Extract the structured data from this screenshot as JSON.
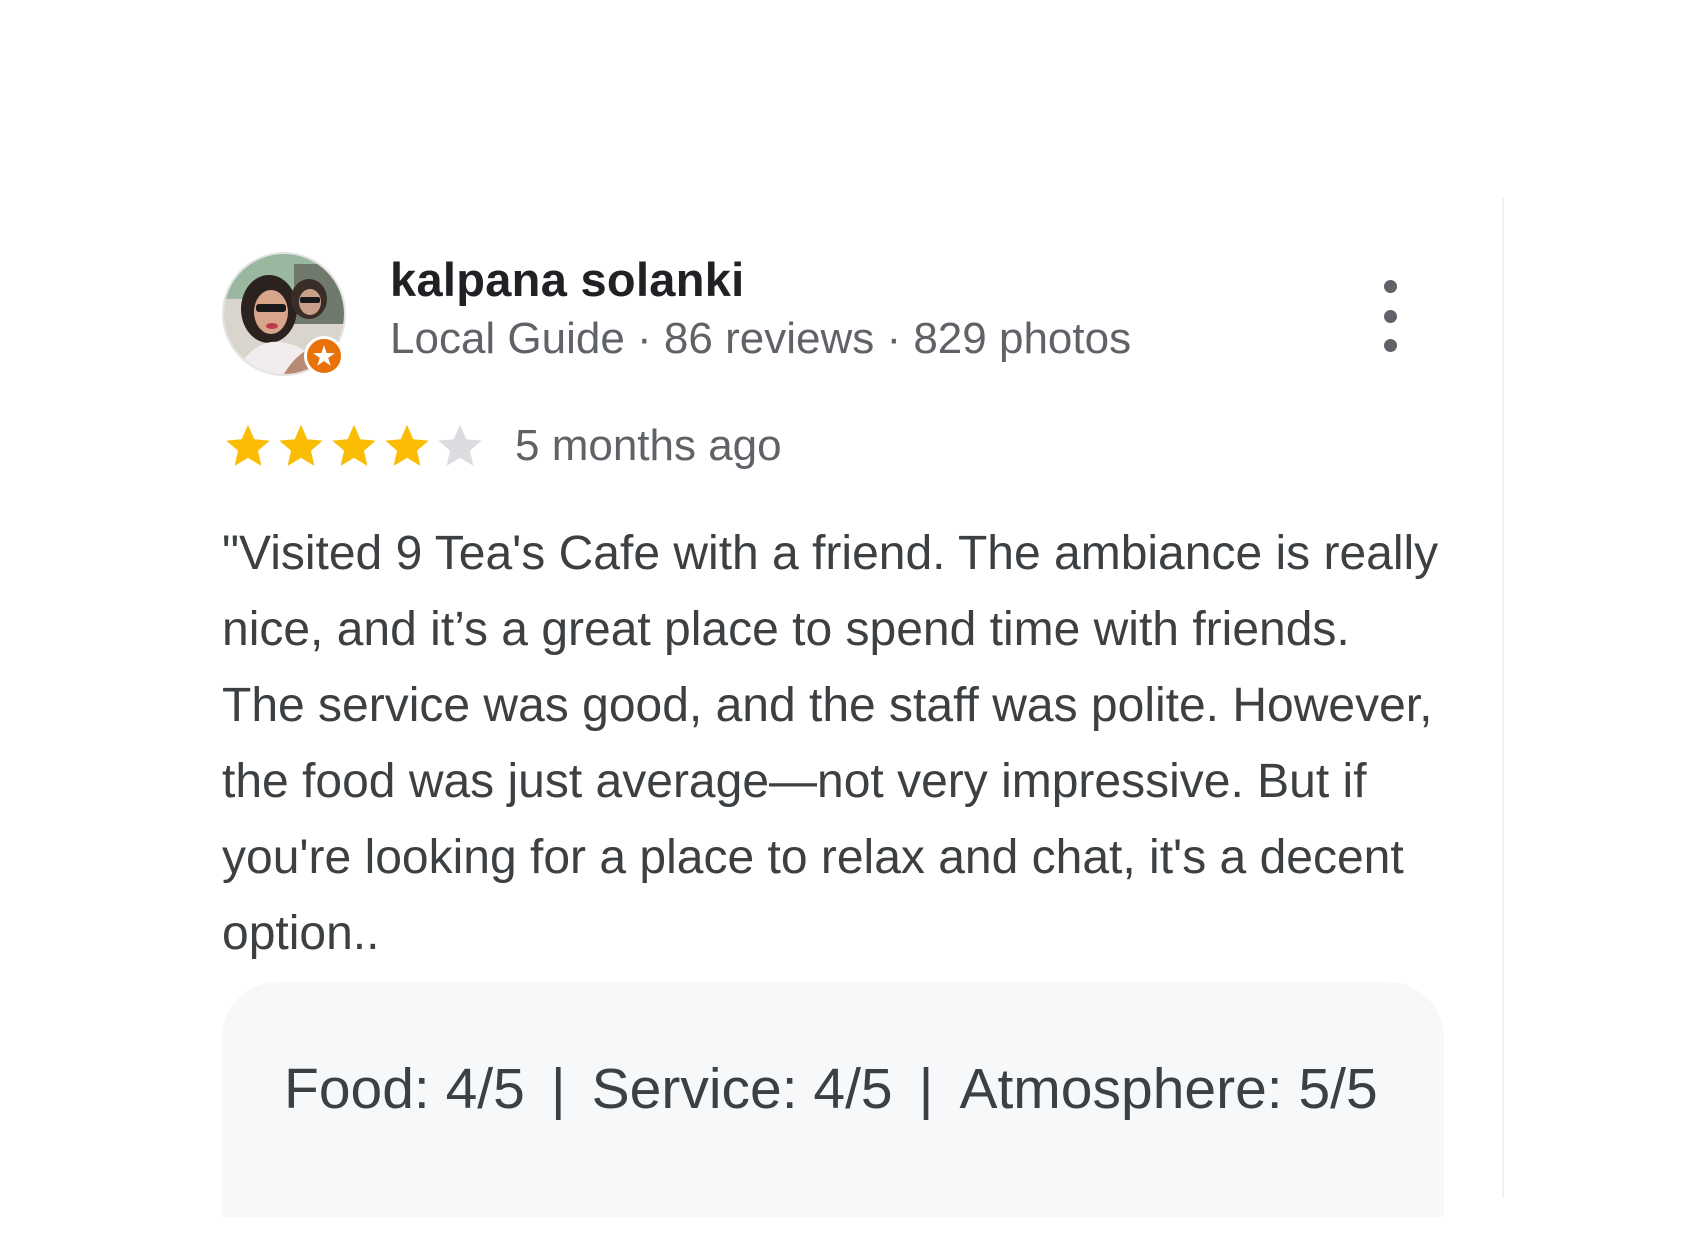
{
  "reviewer": {
    "name": "kalpana solanki",
    "meta": "Local Guide · 86 reviews · 829 photos",
    "avatar_icon": "profile-photo",
    "badge_icon": "local-guide-star-badge"
  },
  "rating": {
    "value": 4,
    "max": 5,
    "filled_color": "#fbbc04",
    "empty_color": "#dadce0",
    "time_ago": "5 months ago"
  },
  "review": {
    "text": "\"Visited 9 Tea's Cafe with a friend. The ambiance is really nice, and it’s a great place to spend time with friends. The service was good, and the staff was polite. However, the food was just average—not very impressive. But if you're looking for a place to relax and chat, it's a decent option.."
  },
  "aspects": {
    "food": "Food: 4/5",
    "separator": "|",
    "service": "Service: 4/5",
    "atmosphere": "Atmosphere: 5/5"
  },
  "menu": {
    "icon": "more-vert-icon"
  }
}
